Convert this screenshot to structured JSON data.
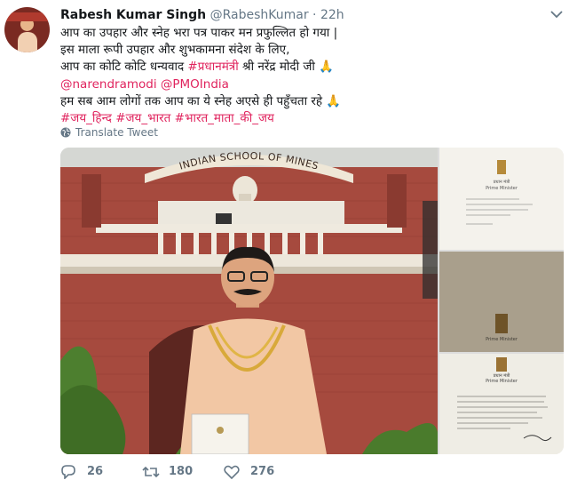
{
  "header": {
    "name": "Rabesh Kumar Singh",
    "handle": "@RabeshKumar",
    "dot": "·",
    "time": "22h"
  },
  "tweet": {
    "line1": "आप का उपहार और स्नेह भरा पत्र पाकर मन प्रफुल्लित हो गया |",
    "line2": "इस माला रूपी उपहार और शुभकामना संदेश के लिए,",
    "line3_prefix": "आप का कोटि कोटि धन्यवाद ",
    "line3_tag": "#प्रधानमंत्री",
    "line3_suffix": " श्री नरेंद्र मोदी जी 🙏",
    "line4_mention1": "@narendramodi",
    "line4_mention2": "@PMOIndia",
    "line5": "हम सब आम लोगों तक आप का ये स्नेह अएसे ही पहुँचता रहे 🙏",
    "line6_tag1": "#जय_हिन्द",
    "line6_tag2": "#जय_भारत",
    "line6_tag3": "#भारत_माता_की_जय"
  },
  "translate": {
    "label": "Translate Tweet"
  },
  "photo": {
    "building_sign": "INDIAN SCHOOL OF MINES"
  },
  "letters": {
    "pm_label": "Prime Minister",
    "pm_label_hindi": "प्रधान मंत्री"
  },
  "actions": {
    "replies": "26",
    "retweets": "180",
    "likes": "276"
  },
  "icons": {
    "reply": "reply-icon",
    "retweet": "retweet-icon",
    "like": "heart-icon",
    "translate": "globe-icon",
    "caret": "chevron-down-icon"
  },
  "colors": {
    "link": "#e0245e",
    "text": "#14171a",
    "muted": "#657786"
  }
}
